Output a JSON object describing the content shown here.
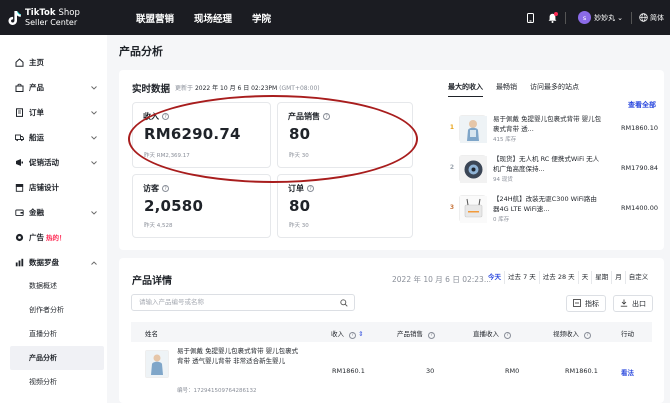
{
  "header": {
    "brand_line1": "TikTok",
    "brand_line1_suffix": "Shop",
    "brand_line2": "Seller Center",
    "nav": [
      "联盟营销",
      "现场经理",
      "学院"
    ],
    "avatar_letter": "s",
    "username": "妙妙丸",
    "language": "简体"
  },
  "sidebar": {
    "items": [
      {
        "label": "主页",
        "icon": "home-icon"
      },
      {
        "label": "产品",
        "icon": "bag-icon"
      },
      {
        "label": "订单",
        "icon": "order-icon"
      },
      {
        "label": "船运",
        "icon": "truck-icon"
      },
      {
        "label": "促销活动",
        "icon": "promo-icon"
      },
      {
        "label": "店铺设计",
        "icon": "store-icon"
      },
      {
        "label": "金融",
        "icon": "wallet-icon"
      },
      {
        "label": "广告",
        "icon": "ads-icon",
        "badge": "热的！"
      },
      {
        "label": "数据罗盘",
        "icon": "compass-icon"
      }
    ],
    "subitems": [
      "数据概述",
      "创作者分析",
      "直播分析",
      "产品分析",
      "视频分析"
    ]
  },
  "page": {
    "title": "产品分析"
  },
  "realtime": {
    "title": "实时数据",
    "updated_label": "更新于",
    "updated_time": "2022 年 10 月 6 日 02:23PM",
    "timezone": "(GMT+08:00)",
    "metrics": [
      {
        "label": "收入",
        "value": "RM6290.74",
        "prev": "昨天 RM2,369.17"
      },
      {
        "label": "产品销售",
        "value": "80",
        "prev": "昨天 30"
      },
      {
        "label": "访客",
        "value": "2,0580",
        "prev": "昨天 4,528"
      },
      {
        "label": "订单",
        "value": "80",
        "prev": "昨天 30"
      }
    ],
    "tabs": [
      "最大的收入",
      "最畅销",
      "访问最多的站点"
    ],
    "view_all": "查看全部",
    "top_products": [
      {
        "rank": "1",
        "name": "易于佩戴 免提婴儿包裹式背带 婴儿包裹式背带 透...",
        "sub": "415 库存",
        "amount": "RM1860.10"
      },
      {
        "rank": "2",
        "name": "【现货】无人机 RC 便携式WiFi 无人机广角高度保持...",
        "sub": "94 现货",
        "amount": "RM1790.84"
      },
      {
        "rank": "3",
        "name": "【24H航】改装无驱C300 WiFi路由器4G LTE WiFi速...",
        "sub": "0 库存",
        "amount": "RM1400.00"
      }
    ],
    "colors": {
      "rank_gold": "#e8a317",
      "rank_silver": "#9aa3ad",
      "rank_bronze": "#c97a43",
      "accent": "#2c4ade",
      "annotation": "#a81d1d"
    }
  },
  "product_detail": {
    "title": "产品详情",
    "date": "2022 年 10 月 6 日 02:23...",
    "periods": [
      "今天",
      "过去 7 天",
      "过去 28 天",
      "天",
      "星期",
      "月",
      "自定义"
    ],
    "active_period": "今天",
    "search_placeholder": "请输入产品编号或名称",
    "metrics_button": "指标",
    "export_button": "出口",
    "columns": [
      "姓名",
      "收入",
      "产品销售",
      "直播收入",
      "视频收入",
      "行动"
    ],
    "rows": [
      {
        "name": "易于佩戴 免提婴儿包裹式背带 婴儿包裹式背带 透气婴儿背带 非常适合新生婴儿",
        "id": "编号：172941509764286132",
        "revenue": "RM1860.1",
        "sales": "30",
        "live": "RM0",
        "video": "RM1860.1",
        "action": "看法"
      }
    ]
  }
}
